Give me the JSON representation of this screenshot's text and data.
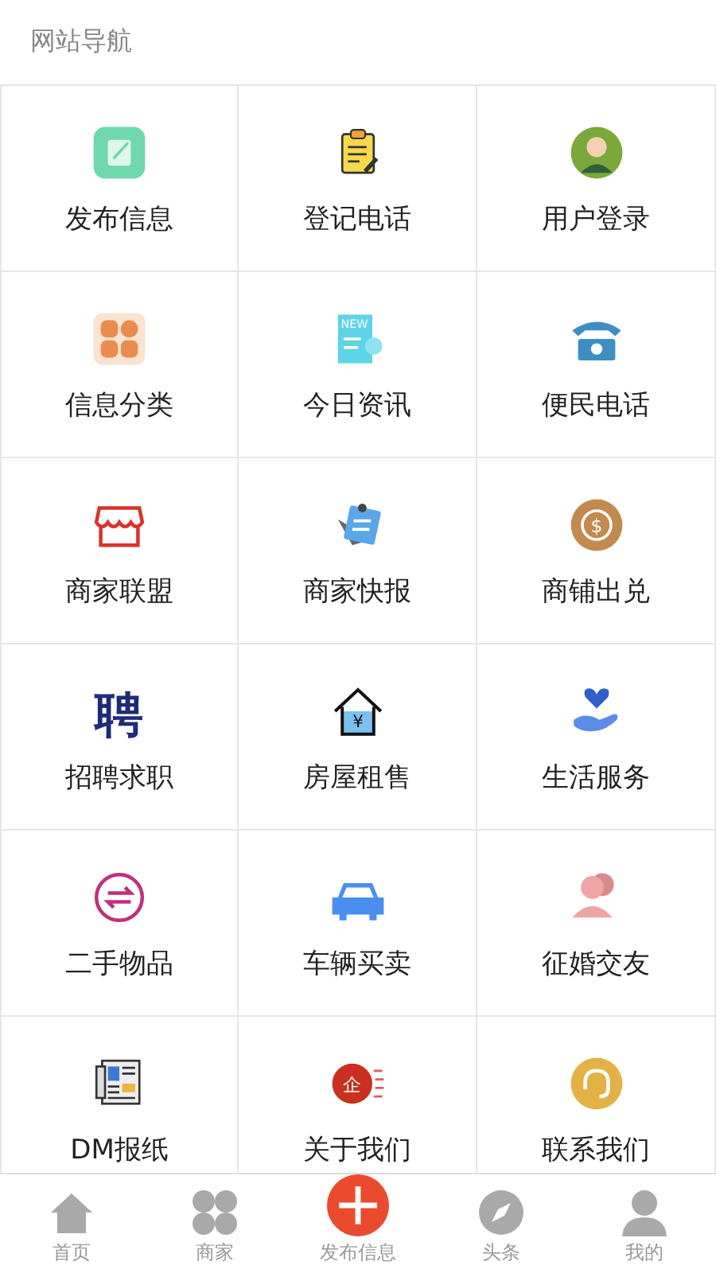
{
  "header": {
    "title": "网站导航"
  },
  "grid": [
    {
      "label": "发布信息",
      "kind": "edit"
    },
    {
      "label": "登记电话",
      "kind": "clipboard"
    },
    {
      "label": "用户登录",
      "kind": "user"
    },
    {
      "label": "信息分类",
      "kind": "category"
    },
    {
      "label": "今日资讯",
      "kind": "news",
      "icon_text": "NEW"
    },
    {
      "label": "便民电话",
      "kind": "phone"
    },
    {
      "label": "商家联盟",
      "kind": "store"
    },
    {
      "label": "商家快报",
      "kind": "memo"
    },
    {
      "label": "商铺出兑",
      "kind": "money",
      "icon_text": "$"
    },
    {
      "label": "招聘求职",
      "kind": "hire",
      "icon_text": "聘"
    },
    {
      "label": "房屋租售",
      "kind": "house",
      "icon_text": "¥"
    },
    {
      "label": "生活服务",
      "kind": "care"
    },
    {
      "label": "二手物品",
      "kind": "swap"
    },
    {
      "label": "车辆买卖",
      "kind": "car"
    },
    {
      "label": "征婚交友",
      "kind": "people"
    },
    {
      "label": "DM报纸",
      "kind": "paper"
    },
    {
      "label": "关于我们",
      "kind": "company",
      "icon_text": "企"
    },
    {
      "label": "联系我们",
      "kind": "headset"
    }
  ],
  "tab_bar": [
    {
      "label": "首页",
      "kind": "home"
    },
    {
      "label": "商家",
      "kind": "clover"
    },
    {
      "label": "发布信息",
      "kind": "plus"
    },
    {
      "label": "头条",
      "kind": "compass"
    },
    {
      "label": "我的",
      "kind": "person"
    }
  ]
}
